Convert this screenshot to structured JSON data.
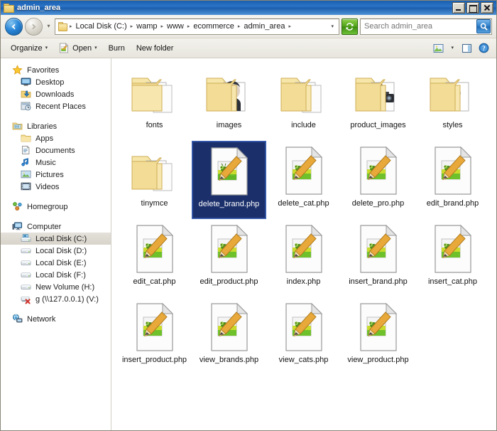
{
  "window": {
    "title": "admin_area",
    "title_icon": "folder-icon",
    "controls": {
      "minimize": "Minimize",
      "maximize": "Maximize",
      "close": "Close"
    }
  },
  "addressbar": {
    "back_tooltip": "Back",
    "forward_tooltip": "Forward",
    "history_tooltip": "Recent pages",
    "folder_icon": "folder-icon",
    "separator": "▸",
    "crumbs": [
      "Local Disk (C:)",
      "wamp",
      "www",
      "ecommerce",
      "admin_area"
    ],
    "dropdown_glyph": "▾",
    "refresh_icon": "refresh-icon",
    "refresh_tooltip": "Refresh",
    "search": {
      "value": "",
      "placeholder": "Search admin_area",
      "button_icon": "search-icon"
    }
  },
  "commandbar": {
    "items": [
      {
        "label": "Organize",
        "has_caret": true,
        "icon": null
      },
      {
        "label": "Open",
        "has_caret": true,
        "icon": "php-file-icon"
      },
      {
        "label": "Burn",
        "has_caret": false,
        "icon": null
      },
      {
        "label": "New folder",
        "has_caret": false,
        "icon": null
      }
    ],
    "right": [
      {
        "name": "preview-pane-icon",
        "caret": true
      },
      {
        "name": "layout-pane-icon",
        "caret": false
      },
      {
        "name": "help-icon",
        "caret": false
      }
    ],
    "caret_glyph": "▾"
  },
  "navpane": {
    "groups": [
      {
        "header": {
          "label": "Favorites",
          "icon": "star-icon"
        },
        "items": [
          {
            "label": "Desktop",
            "icon": "desktop-icon"
          },
          {
            "label": "Downloads",
            "icon": "downloads-icon"
          },
          {
            "label": "Recent Places",
            "icon": "recent-places-icon"
          }
        ]
      },
      {
        "header": {
          "label": "Libraries",
          "icon": "libraries-icon"
        },
        "items": [
          {
            "label": "Apps",
            "icon": "folder-icon"
          },
          {
            "label": "Documents",
            "icon": "documents-library-icon"
          },
          {
            "label": "Music",
            "icon": "music-library-icon"
          },
          {
            "label": "Pictures",
            "icon": "pictures-library-icon"
          },
          {
            "label": "Videos",
            "icon": "videos-library-icon"
          }
        ]
      },
      {
        "header": {
          "label": "Homegroup",
          "icon": "homegroup-icon"
        },
        "items": []
      },
      {
        "header": {
          "label": "Computer",
          "icon": "computer-icon"
        },
        "items": [
          {
            "label": "Local Disk (C:)",
            "icon": "system-drive-icon",
            "selected": true
          },
          {
            "label": "Local Disk (D:)",
            "icon": "drive-icon"
          },
          {
            "label": "Local Disk (E:)",
            "icon": "drive-icon"
          },
          {
            "label": "Local Disk (F:)",
            "icon": "drive-icon"
          },
          {
            "label": "New Volume (H:)",
            "icon": "drive-icon"
          },
          {
            "label": "g (\\\\127.0.0.1) (V:)",
            "icon": "disconnected-network-drive-icon"
          }
        ]
      },
      {
        "header": {
          "label": "Network",
          "icon": "network-icon"
        },
        "items": []
      }
    ]
  },
  "files": [
    {
      "name": "fonts",
      "type": "folder",
      "overlay": "documents"
    },
    {
      "name": "images",
      "type": "folder",
      "overlay": "person"
    },
    {
      "name": "include",
      "type": "folder",
      "overlay": "documents"
    },
    {
      "name": "product_images",
      "type": "folder",
      "overlay": "photo"
    },
    {
      "name": "styles",
      "type": "folder",
      "overlay": "blank"
    },
    {
      "name": "tinymce",
      "type": "folder",
      "overlay": "documents"
    },
    {
      "name": "delete_brand.php",
      "type": "php",
      "selected": true
    },
    {
      "name": "delete_cat.php",
      "type": "php"
    },
    {
      "name": "delete_pro.php",
      "type": "php"
    },
    {
      "name": "edit_brand.php",
      "type": "php"
    },
    {
      "name": "edit_cat.php",
      "type": "php"
    },
    {
      "name": "edit_product.php",
      "type": "php"
    },
    {
      "name": "index.php",
      "type": "php"
    },
    {
      "name": "insert_brand.php",
      "type": "php"
    },
    {
      "name": "insert_cat.php",
      "type": "php"
    },
    {
      "name": "insert_product.php",
      "type": "php"
    },
    {
      "name": "view_brands.php",
      "type": "php"
    },
    {
      "name": "view_cats.php",
      "type": "php"
    },
    {
      "name": "view_product.php",
      "type": "php"
    }
  ],
  "colors": {
    "titlebar_blue": "#2b74c6",
    "selection_navy": "#1b2f6b",
    "selection_border": "#3c63b4",
    "folder_yellow": "#f0d386",
    "refresh_green": "#4fa318",
    "nav_selected": "#ddd9d1"
  }
}
